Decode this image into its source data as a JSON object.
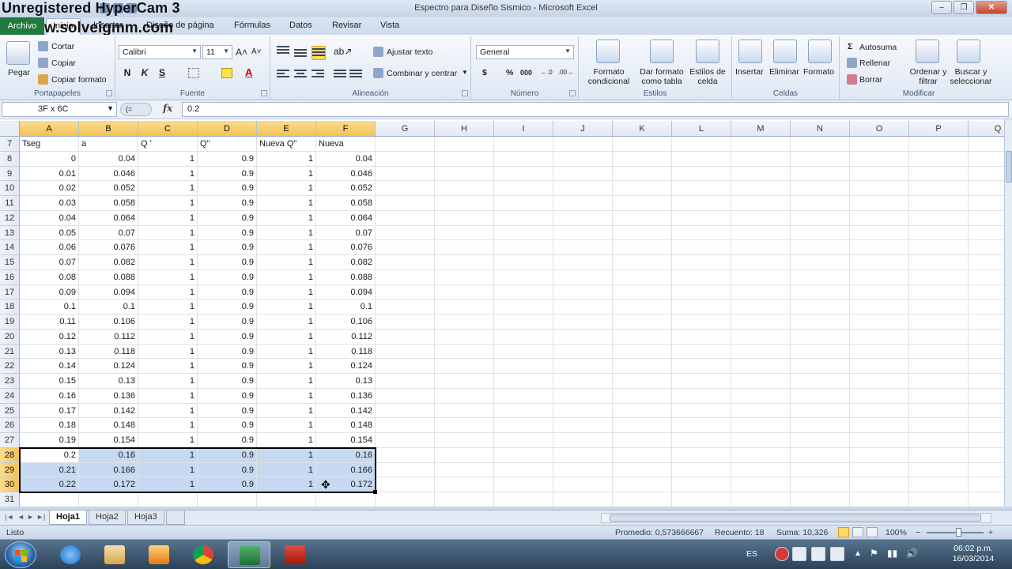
{
  "watermark": {
    "line1": "Unregistered HyperCam 3",
    "line2": "w.solveigmm.com"
  },
  "window": {
    "title": "Espectro para Diseño Sismico - Microsoft Excel"
  },
  "tabs": {
    "file": "Archivo",
    "items": [
      "Inicio",
      "Insertar",
      "Diseño de página",
      "Fórmulas",
      "Datos",
      "Revisar",
      "Vista"
    ]
  },
  "ribbon": {
    "clipboard": {
      "paste": "Pegar",
      "cut": "Cortar",
      "copy": "Copiar",
      "format_painter": "Copiar formato",
      "label": "Portapapeles"
    },
    "font": {
      "name": "Calibri",
      "size": "11",
      "bold": "N",
      "italic": "K",
      "underline": "S",
      "label": "Fuente"
    },
    "alignment": {
      "wrap": "Ajustar texto",
      "merge": "Combinar y centrar",
      "label": "Alineación"
    },
    "number": {
      "format": "General",
      "currency": "$",
      "percent": "%",
      "thousands": "000",
      "label": "Número"
    },
    "styles": {
      "conditional": "Formato condicional",
      "table": "Dar formato como tabla",
      "cell": "Estilos de celda",
      "label": "Estilos"
    },
    "cells": {
      "insert": "Insertar",
      "delete": "Eliminar",
      "format": "Formato",
      "label": "Celdas"
    },
    "editing": {
      "autosum": "Autosuma",
      "fill": "Rellenar",
      "clear": "Borrar",
      "sort": "Ordenar y filtrar",
      "find": "Buscar y seleccionar",
      "label": "Modificar"
    }
  },
  "formula_bar": {
    "name_box": "3F x 6C",
    "fx": "fx",
    "value": "0.2"
  },
  "sheet": {
    "columns": [
      "A",
      "B",
      "C",
      "D",
      "E",
      "F",
      "G",
      "H",
      "I",
      "J",
      "K",
      "L",
      "M",
      "N",
      "O",
      "P",
      "Q"
    ],
    "header_row": {
      "row": "7",
      "cells": [
        "Tseg",
        "a",
        "Q '",
        "Q\"",
        "Nueva Q\"",
        "Nueva"
      ]
    },
    "rows": [
      {
        "row": "8",
        "cells": [
          "0",
          "0.04",
          "1",
          "0.9",
          "1",
          "0.04"
        ]
      },
      {
        "row": "9",
        "cells": [
          "0.01",
          "0.046",
          "1",
          "0.9",
          "1",
          "0.046"
        ]
      },
      {
        "row": "10",
        "cells": [
          "0.02",
          "0.052",
          "1",
          "0.9",
          "1",
          "0.052"
        ]
      },
      {
        "row": "11",
        "cells": [
          "0.03",
          "0.058",
          "1",
          "0.9",
          "1",
          "0.058"
        ]
      },
      {
        "row": "12",
        "cells": [
          "0.04",
          "0.064",
          "1",
          "0.9",
          "1",
          "0.064"
        ]
      },
      {
        "row": "13",
        "cells": [
          "0.05",
          "0.07",
          "1",
          "0.9",
          "1",
          "0.07"
        ]
      },
      {
        "row": "14",
        "cells": [
          "0.06",
          "0.076",
          "1",
          "0.9",
          "1",
          "0.076"
        ]
      },
      {
        "row": "15",
        "cells": [
          "0.07",
          "0.082",
          "1",
          "0.9",
          "1",
          "0.082"
        ]
      },
      {
        "row": "16",
        "cells": [
          "0.08",
          "0.088",
          "1",
          "0.9",
          "1",
          "0.088"
        ]
      },
      {
        "row": "17",
        "cells": [
          "0.09",
          "0.094",
          "1",
          "0.9",
          "1",
          "0.094"
        ]
      },
      {
        "row": "18",
        "cells": [
          "0.1",
          "0.1",
          "1",
          "0.9",
          "1",
          "0.1"
        ]
      },
      {
        "row": "19",
        "cells": [
          "0.11",
          "0.106",
          "1",
          "0.9",
          "1",
          "0.106"
        ]
      },
      {
        "row": "20",
        "cells": [
          "0.12",
          "0.112",
          "1",
          "0.9",
          "1",
          "0.112"
        ]
      },
      {
        "row": "21",
        "cells": [
          "0.13",
          "0.118",
          "1",
          "0.9",
          "1",
          "0.118"
        ]
      },
      {
        "row": "22",
        "cells": [
          "0.14",
          "0.124",
          "1",
          "0.9",
          "1",
          "0.124"
        ]
      },
      {
        "row": "23",
        "cells": [
          "0.15",
          "0.13",
          "1",
          "0.9",
          "1",
          "0.13"
        ]
      },
      {
        "row": "24",
        "cells": [
          "0.16",
          "0.136",
          "1",
          "0.9",
          "1",
          "0.136"
        ]
      },
      {
        "row": "25",
        "cells": [
          "0.17",
          "0.142",
          "1",
          "0.9",
          "1",
          "0.142"
        ]
      },
      {
        "row": "26",
        "cells": [
          "0.18",
          "0.148",
          "1",
          "0.9",
          "1",
          "0.148"
        ]
      },
      {
        "row": "27",
        "cells": [
          "0.19",
          "0.154",
          "1",
          "0.9",
          "1",
          "0.154"
        ]
      },
      {
        "row": "28",
        "cells": [
          "0.2",
          "0.16",
          "1",
          "0.9",
          "1",
          "0.16"
        ],
        "selected": true
      },
      {
        "row": "29",
        "cells": [
          "0.21",
          "0.166",
          "1",
          "0.9",
          "1",
          "0.166"
        ],
        "selected": true
      },
      {
        "row": "30",
        "cells": [
          "0.22",
          "0.172",
          "1",
          "0.9",
          "1",
          "0.172"
        ],
        "selected": true
      },
      {
        "row": "31",
        "cells": [
          "",
          "",
          "",
          "",
          "",
          ""
        ]
      }
    ]
  },
  "sheet_tabs": [
    "Hoja1",
    "Hoja2",
    "Hoja3"
  ],
  "status": {
    "mode": "Listo",
    "average": "Promedio: 0,573666667",
    "count": "Recuento: 18",
    "sum": "Suma: 10,326",
    "zoom": "100%"
  },
  "taskbar": {
    "language": "ES",
    "time": "06:02 p.m.",
    "date": "16/03/2014"
  },
  "colors": {
    "accent_green": "#1f7a3d",
    "selection_fill": "#c6d9f1",
    "header_highlight": "#f4c257"
  }
}
